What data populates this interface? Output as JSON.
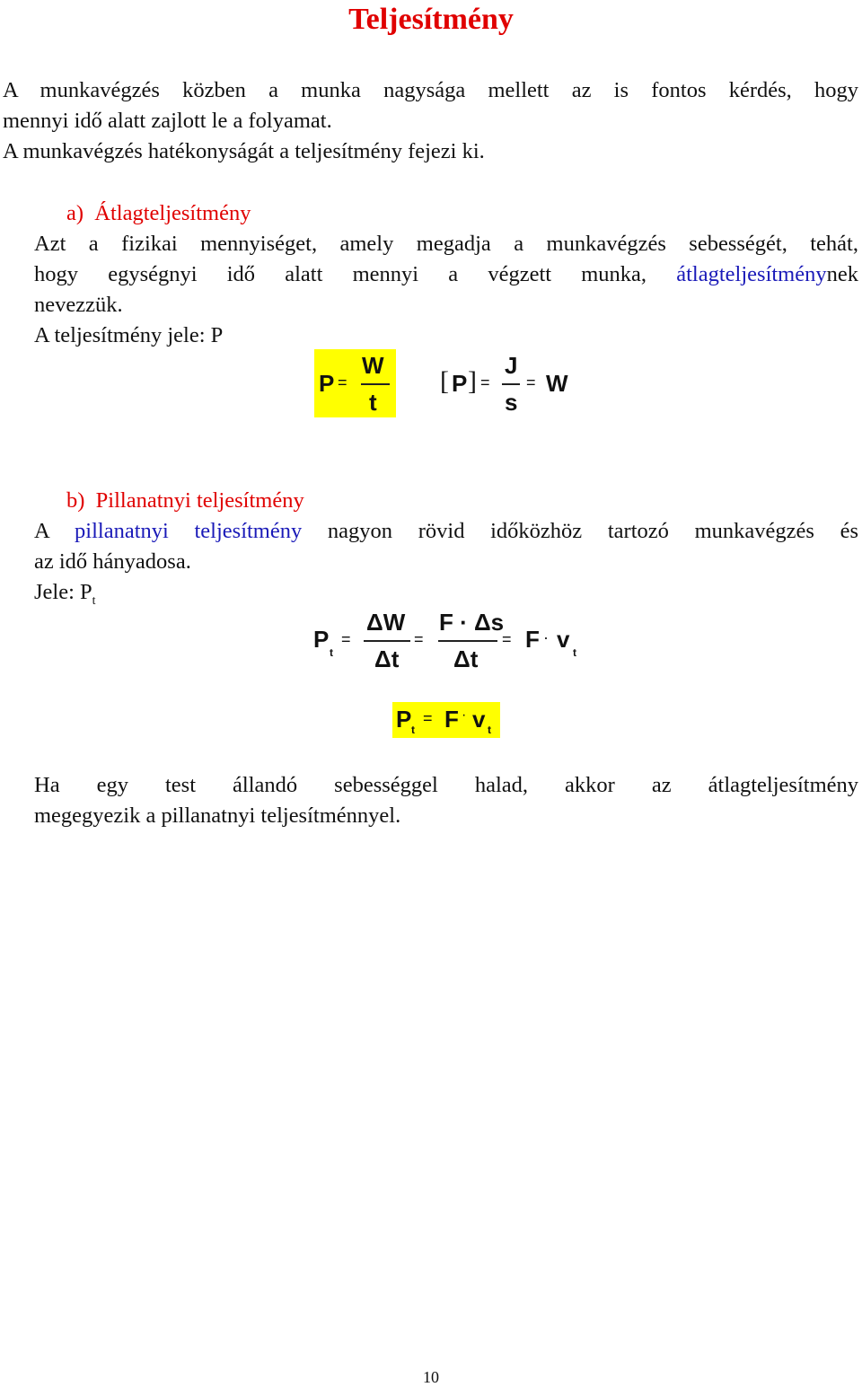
{
  "title": "Teljesítmény",
  "intro": {
    "line1": "A munkavégzés közben a munka nagysága mellett az is fontos kérdés, hogy",
    "line2": "mennyi idő alatt zajlott le a folyamat.",
    "line3": "A munkavégzés hatékonyságát a teljesítmény fejezi ki."
  },
  "section_a": {
    "heading": "a)  Átlagteljesítmény",
    "line1": "Azt a fizikai mennyiséget, amely megadja a munkavégzés sebességét, tehát,",
    "line2_pre": "hogy egységnyi idő alatt mennyi a végzett munka, ",
    "line2_term": "átlagteljesítmény",
    "line2_post": "nek",
    "line3": "nevezzük.",
    "symbol_line": "A teljesítmény jele: P",
    "formula": {
      "lhs": "P",
      "eq": "=",
      "num": "W",
      "den": "t"
    },
    "unit_formula": {
      "lbracket": "[",
      "sym": "P",
      "rbracket": "]",
      "eq1": "=",
      "num": "J",
      "den": "s",
      "eq2": "=",
      "result": "W"
    }
  },
  "section_b": {
    "heading": "b)  Pillanatnyi teljesítmény",
    "line1_pre": "A ",
    "line1_term": "pillanatnyi teljesítmény",
    "line1_post": " nagyon rövid időközhöz tartozó munkavégzés és",
    "line2": "az idő hányadosa.",
    "symbol_label": "Jele: P",
    "symbol_sub": "t",
    "formula": {
      "lhs": "P",
      "lhs_sub": "t",
      "eq1": "=",
      "frac1_num": "ΔW",
      "frac1_den": "Δt",
      "eq2": "=",
      "frac2_num": "F · Δs",
      "frac2_den": "Δt",
      "eq3": "=",
      "rhs_F": "F",
      "dot": "·",
      "rhs_v": "v",
      "rhs_sub": "t"
    },
    "boxed": {
      "lhs": "P",
      "lhs_sub": "t",
      "eq": "=",
      "F": "F",
      "dot": "·",
      "v": "v",
      "v_sub": "t"
    }
  },
  "conclusion": {
    "line1": "Ha egy test állandó sebességgel halad, akkor az átlagteljesítmény",
    "line2": "megegyezik a pillanatnyi teljesítménnyel."
  },
  "page_number": "10",
  "colors": {
    "heading": "#e00000",
    "term": "#1a1ab8",
    "highlight": "#ffff00"
  }
}
